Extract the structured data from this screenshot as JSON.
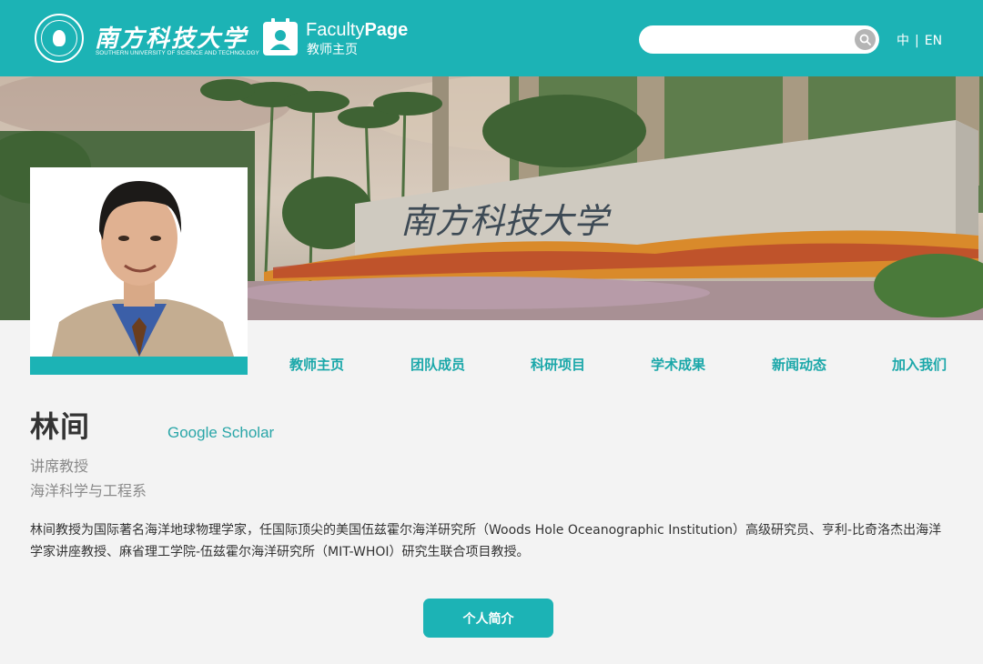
{
  "header": {
    "university_cn": "南方科技大学",
    "university_en": "SOUTHERN UNIVERSITY OF SCIENCE AND TECHNOLOGY",
    "facultypage_light": "Faculty",
    "facultypage_bold": "Page",
    "facultypage_sub": "教师主页",
    "search_value": "",
    "lang_cn": "中",
    "lang_sep": "|",
    "lang_en": "EN",
    "accent_color": "#1cb3b5"
  },
  "banner": {
    "stone_text": "南方科技大学"
  },
  "nav": {
    "items": [
      "教师主页",
      "团队成员",
      "科研项目",
      "学术成果",
      "新闻动态",
      "加入我们"
    ]
  },
  "profile": {
    "name": "林间",
    "scholar_link": "Google Scholar",
    "title": "讲席教授",
    "department": "海洋科学与工程系",
    "bio": "林间教授为国际著名海洋地球物理学家，任国际顶尖的美国伍兹霍尔海洋研究所（Woods Hole Oceanographic Institution）高级研究员、亨利-比奇洛杰出海洋学家讲座教授、麻省理工学院-伍兹霍尔海洋研究所（MIT-WHOI）研究生联合项目教授。",
    "button_label": "个人简介"
  },
  "icons": [
    "university-seal-icon",
    "faculty-page-icon",
    "search-icon"
  ]
}
